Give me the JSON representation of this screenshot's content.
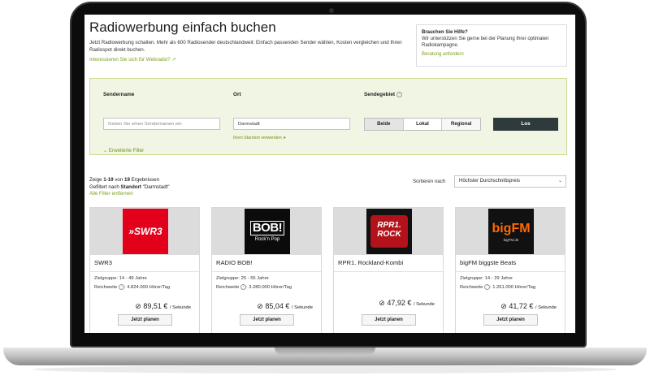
{
  "page": {
    "title": "Radiowerbung einfach buchen",
    "intro": "Jetzt Radiowerbung schalten. Mehr als 600 Radiosender deutschlandweit: Einfach passenden Sender wählen, Kosten vergleichen und Ihren Radiospot direkt buchen.",
    "webradio_link": "Interessieren Sie sich für Webradio?"
  },
  "help": {
    "title": "Brauchen Sie Hilfe?",
    "text": "Wir unterstützen Sie gerne bei der Planung Ihrer optimalen Radiokampagne.",
    "link": "Beratung anfordern"
  },
  "filter": {
    "sender_label": "Sendername",
    "sender_placeholder": "Geben Sie einen Sendernamen ein",
    "ort_label": "Ort",
    "ort_value": "Darmstadt",
    "locate_link": "Ihren Standort verwenden",
    "gebiet_label": "Sendegebiet",
    "gebiet_options": [
      "Beide",
      "Lokal",
      "Regional"
    ],
    "submit_label": "Los",
    "advanced_label": "Erweiterte Filter"
  },
  "results": {
    "count_prefix": "Zeige ",
    "range": "1-19",
    "count_mid": " von ",
    "total": "19",
    "count_suffix": " Ergebnissen",
    "filtered_prefix": "Gefiltert nach ",
    "filtered_key": "Standort",
    "filtered_value": " \"Darmstadt\"",
    "remove_filters": "Alle Filter entfernen",
    "sort_label": "Sortieren nach",
    "sort_value": "Höchster Durchschnittspreis"
  },
  "cards": [
    {
      "logo_text": "»SWR3",
      "name": "SWR3",
      "zielgruppe": "Zielgruppe: 14 - 49 Jahre",
      "reichweite_label": "Reichweite",
      "reichweite_value": "4.824.000 Hörer/Tag",
      "price": "89,51 €",
      "unit": "/ Sekunde",
      "button": "Jetzt planen"
    },
    {
      "logo_text": "BOB!",
      "logo_sub": "Rock'n Pop",
      "name": "RADIO BOB!",
      "zielgruppe": "Zielgruppe: 25 - 55 Jahre",
      "reichweite_label": "Reichweite",
      "reichweite_value": "3.280.000 Hörer/Tag",
      "price": "85,04 €",
      "unit": "/ Sekunde",
      "button": "Jetzt planen"
    },
    {
      "logo_text": "RPR1. ROCK",
      "name": "RPR1. Rockland-Kombi",
      "price": "47,92 €",
      "unit": "/ Sekunde",
      "button": "Jetzt planen"
    },
    {
      "logo_text": "bigFM",
      "logo_sub": "bigFM.de",
      "name": "bigFM biggste Beats",
      "zielgruppe": "Zielgruppe: 14 - 29 Jahre",
      "reichweite_label": "Reichweite",
      "reichweite_value": "1.261.000 Hörer/Tag",
      "price": "41,72 €",
      "unit": "/ Sekunde",
      "button": "Jetzt planen"
    }
  ],
  "icons": {
    "price_symbol": "⊘",
    "info_symbol": "?",
    "external_link": "↗",
    "chevron": "⌄",
    "locate": "➤"
  },
  "colors": {
    "accent_green": "#7aa01d",
    "filter_bg": "#f1f6e4",
    "submit_bg": "#2f3a3d",
    "swr3_red": "#e2001a"
  }
}
